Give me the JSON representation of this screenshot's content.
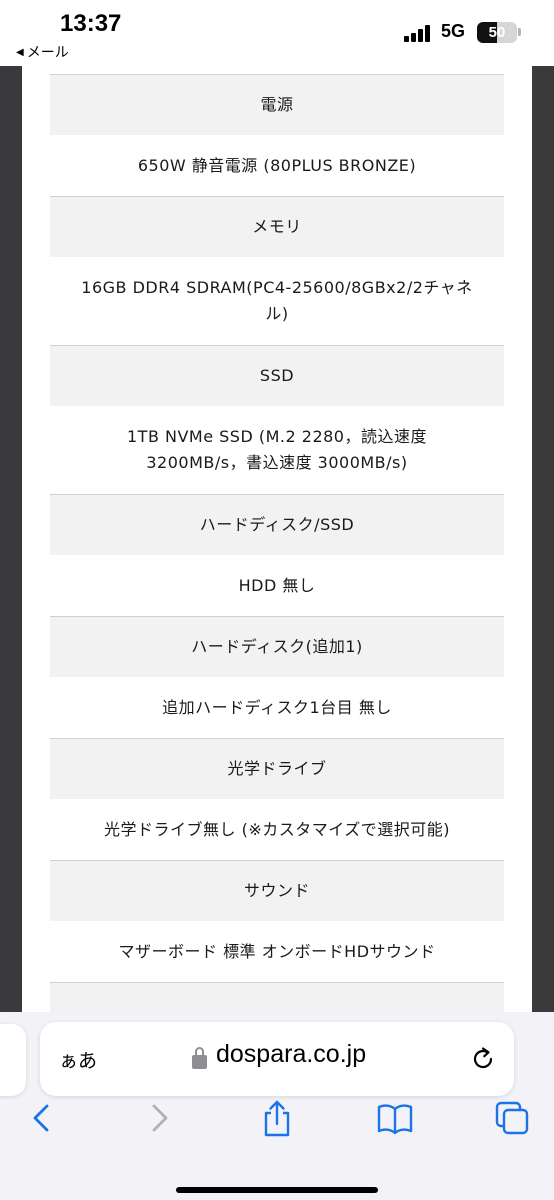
{
  "status_bar": {
    "time": "13:37",
    "back_app": "メール",
    "network": "5G",
    "battery": "50",
    "battery_level": 0.5
  },
  "spec_rows": [
    {
      "label": "電源",
      "value": "650W 静音電源 (80PLUS BRONZE)"
    },
    {
      "label": "メモリ",
      "value": "16GB DDR4 SDRAM(PC4-25600/8GBx2/2チャネル)"
    },
    {
      "label": "SSD",
      "value": "1TB NVMe SSD (M.2 2280，読込速度 3200MB/s，書込速度 3000MB/s)"
    },
    {
      "label": "ハードディスク/SSD",
      "value": "HDD 無し"
    },
    {
      "label": "ハードディスク(追加1)",
      "value": "追加ハードディスク1台目 無し"
    },
    {
      "label": "光学ドライブ",
      "value": "光学ドライブ無し (※カスタマイズで選択可能)"
    },
    {
      "label": "サウンド",
      "value": "マザーボード 標準 オンボードHDサウンド"
    }
  ],
  "browser": {
    "aa_label": "ぁあ",
    "domain": "dospara.co.jp",
    "accent_color": "#1a73e8",
    "disabled_color": "#b0b0b5",
    "icons": [
      "back-icon",
      "forward-icon",
      "share-icon",
      "bookmarks-icon",
      "tabs-icon",
      "reload-icon",
      "lock-icon"
    ]
  }
}
